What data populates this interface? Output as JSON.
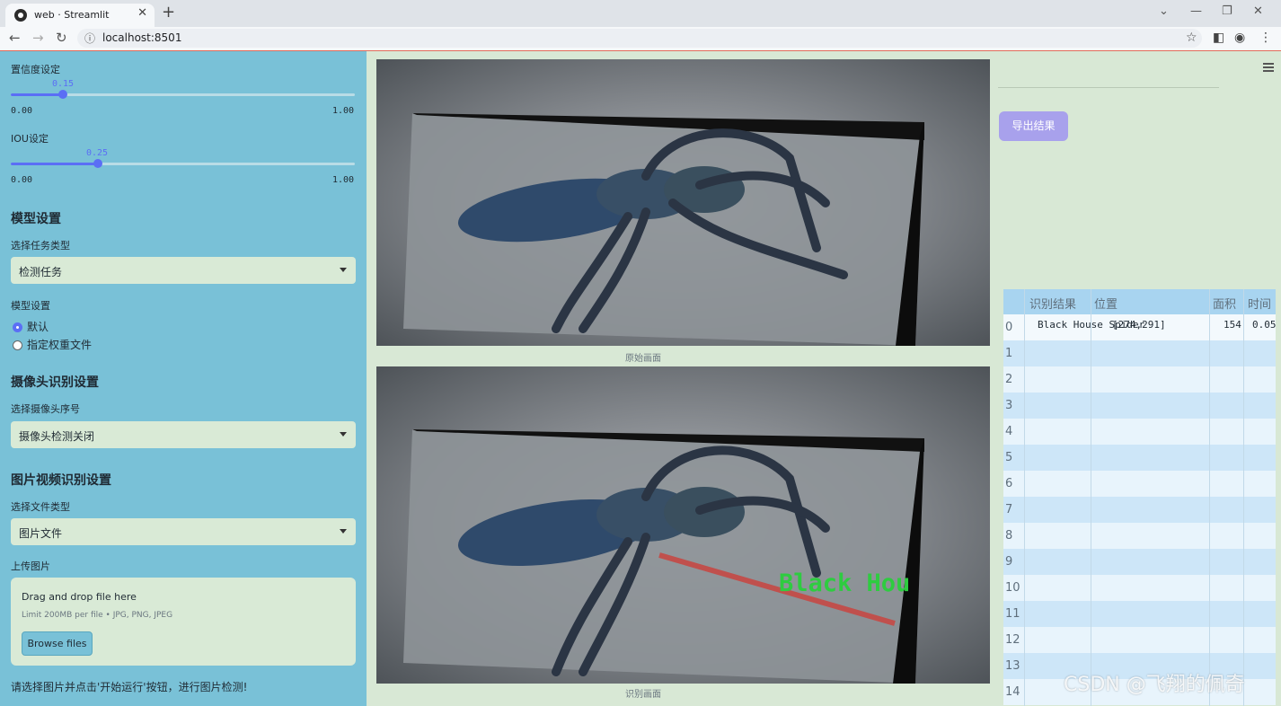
{
  "browser": {
    "tab_title": "web · Streamlit",
    "url": "localhost:8501"
  },
  "sidebar": {
    "confidence": {
      "label": "置信度设定",
      "value": "0.15",
      "min": "0.00",
      "max": "1.00",
      "fraction": 0.15
    },
    "iou": {
      "label": "IOU设定",
      "value": "0.25",
      "min": "0.00",
      "max": "1.00",
      "fraction": 0.25
    },
    "model_section": "模型设置",
    "task_label": "选择任务类型",
    "task_value": "检测任务",
    "model_label": "模型设置",
    "model_options": [
      "默认",
      "指定权重文件"
    ],
    "model_selected": 0,
    "camera_section": "摄像头识别设置",
    "camera_label": "选择摄像头序号",
    "camera_value": "摄像头检测关闭",
    "media_section": "图片视频识别设置",
    "filetype_label": "选择文件类型",
    "filetype_value": "图片文件",
    "upload_label": "上传图片",
    "uploader": {
      "drag_text": "Drag and drop file here",
      "limit_text": "Limit 200MB per file • JPG, PNG, JPEG",
      "browse_label": "Browse files"
    },
    "hint": "请选择图片并点击'开始运行'按钮，进行图片检测!"
  },
  "main": {
    "original_caption": "原始画面",
    "result_caption": "识别画面",
    "detection_label_text": "Black Hou",
    "export_button": "导出结果",
    "table": {
      "headers": [
        "识别结果",
        "位置",
        "面积",
        "时间"
      ],
      "row_indices": [
        "0",
        "1",
        "2",
        "3",
        "4",
        "5",
        "6",
        "7",
        "8",
        "9",
        "10",
        "11",
        "12",
        "13",
        "14"
      ],
      "rows": [
        {
          "result": "Black House Spider",
          "position": "[274,291]",
          "area": "154",
          "time": "0.05"
        }
      ]
    }
  },
  "watermark": "CSDN @飞翔的佩奇",
  "colors": {
    "sidebar_bg": "#79c1d7",
    "main_bg": "#d8e8d5",
    "accent": "#5b6ef5",
    "export_button": "#a8a1ec",
    "detection_label": "#2ecc40",
    "detection_line": "#c0504d"
  },
  "icons": [
    "back-arrow-icon",
    "forward-arrow-icon",
    "reload-icon",
    "info-icon",
    "star-icon",
    "profile-icon",
    "menu-dots-icon",
    "hamburger-menu-icon",
    "caret-down-icon"
  ]
}
